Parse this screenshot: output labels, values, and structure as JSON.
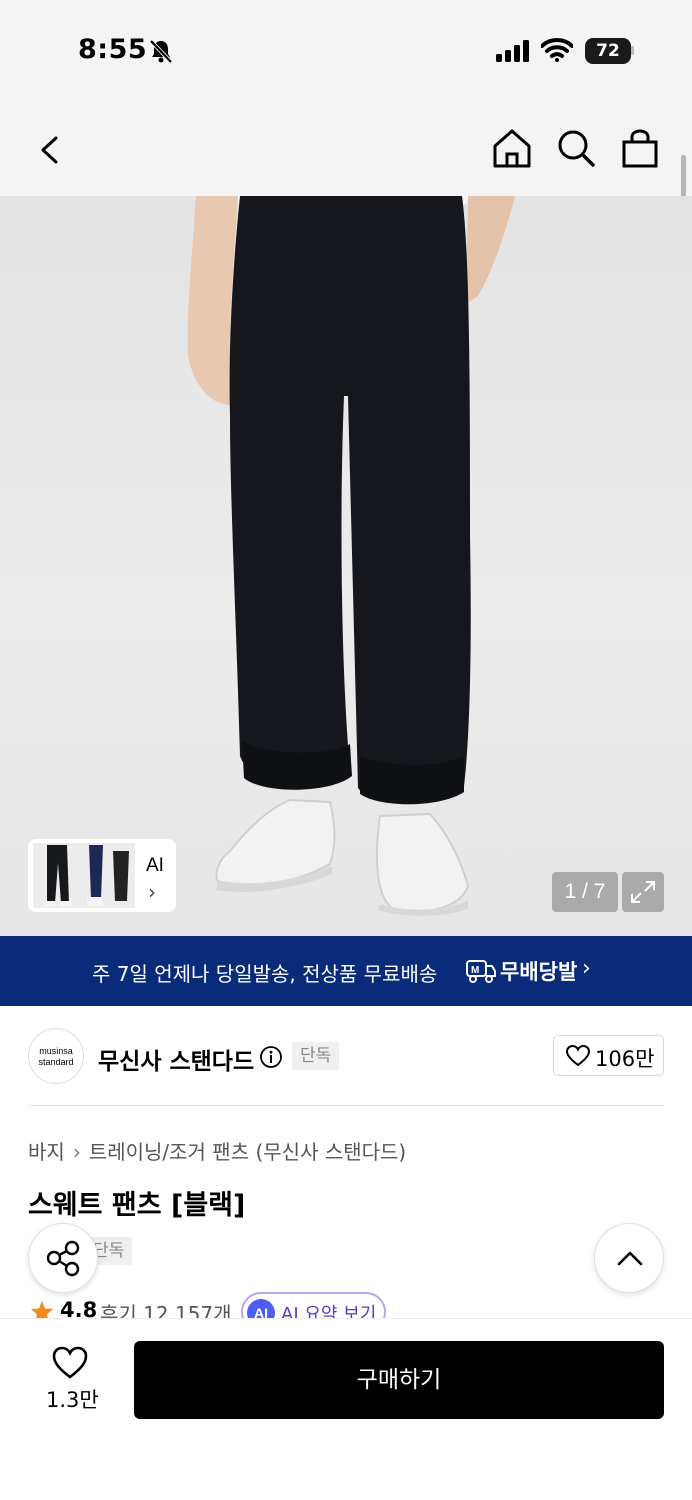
{
  "status_bar": {
    "time": "8:55",
    "battery": "72"
  },
  "nav": {
    "icons": [
      "back-icon",
      "home-icon",
      "search-icon",
      "shopping-bag-icon"
    ]
  },
  "hero": {
    "ai_thumb_label": "AI",
    "ai_thumb_chevron": "›",
    "counter": "1 / 7"
  },
  "banner": {
    "text": "주 7일 언제나 당일발송, 전상품 무료배송",
    "brand": "무배당발",
    "chevron": "›",
    "color": "#0a2b7a"
  },
  "brand": {
    "logo_line1": "musinsa",
    "logo_line2": "standard",
    "name": "무신사 스탠다드",
    "badge": "단독",
    "likes": "106만"
  },
  "product": {
    "breadcrumb": [
      "바지",
      "트레이닝/조거 팬츠 (무신사 스탠다드)"
    ],
    "breadcrumb_sep": "›",
    "title": "스웨트 팬츠 [블랙]",
    "exclusive_badge": "단독",
    "rating": "4.8",
    "reviews": "후기 12,157개",
    "ai_icon": "AI",
    "ai_summary": "AI 요약 보기",
    "ai_accent": "#4d5df5"
  },
  "bottom_bar": {
    "wish_count": "1.3만",
    "buy_label": "구매하기"
  }
}
